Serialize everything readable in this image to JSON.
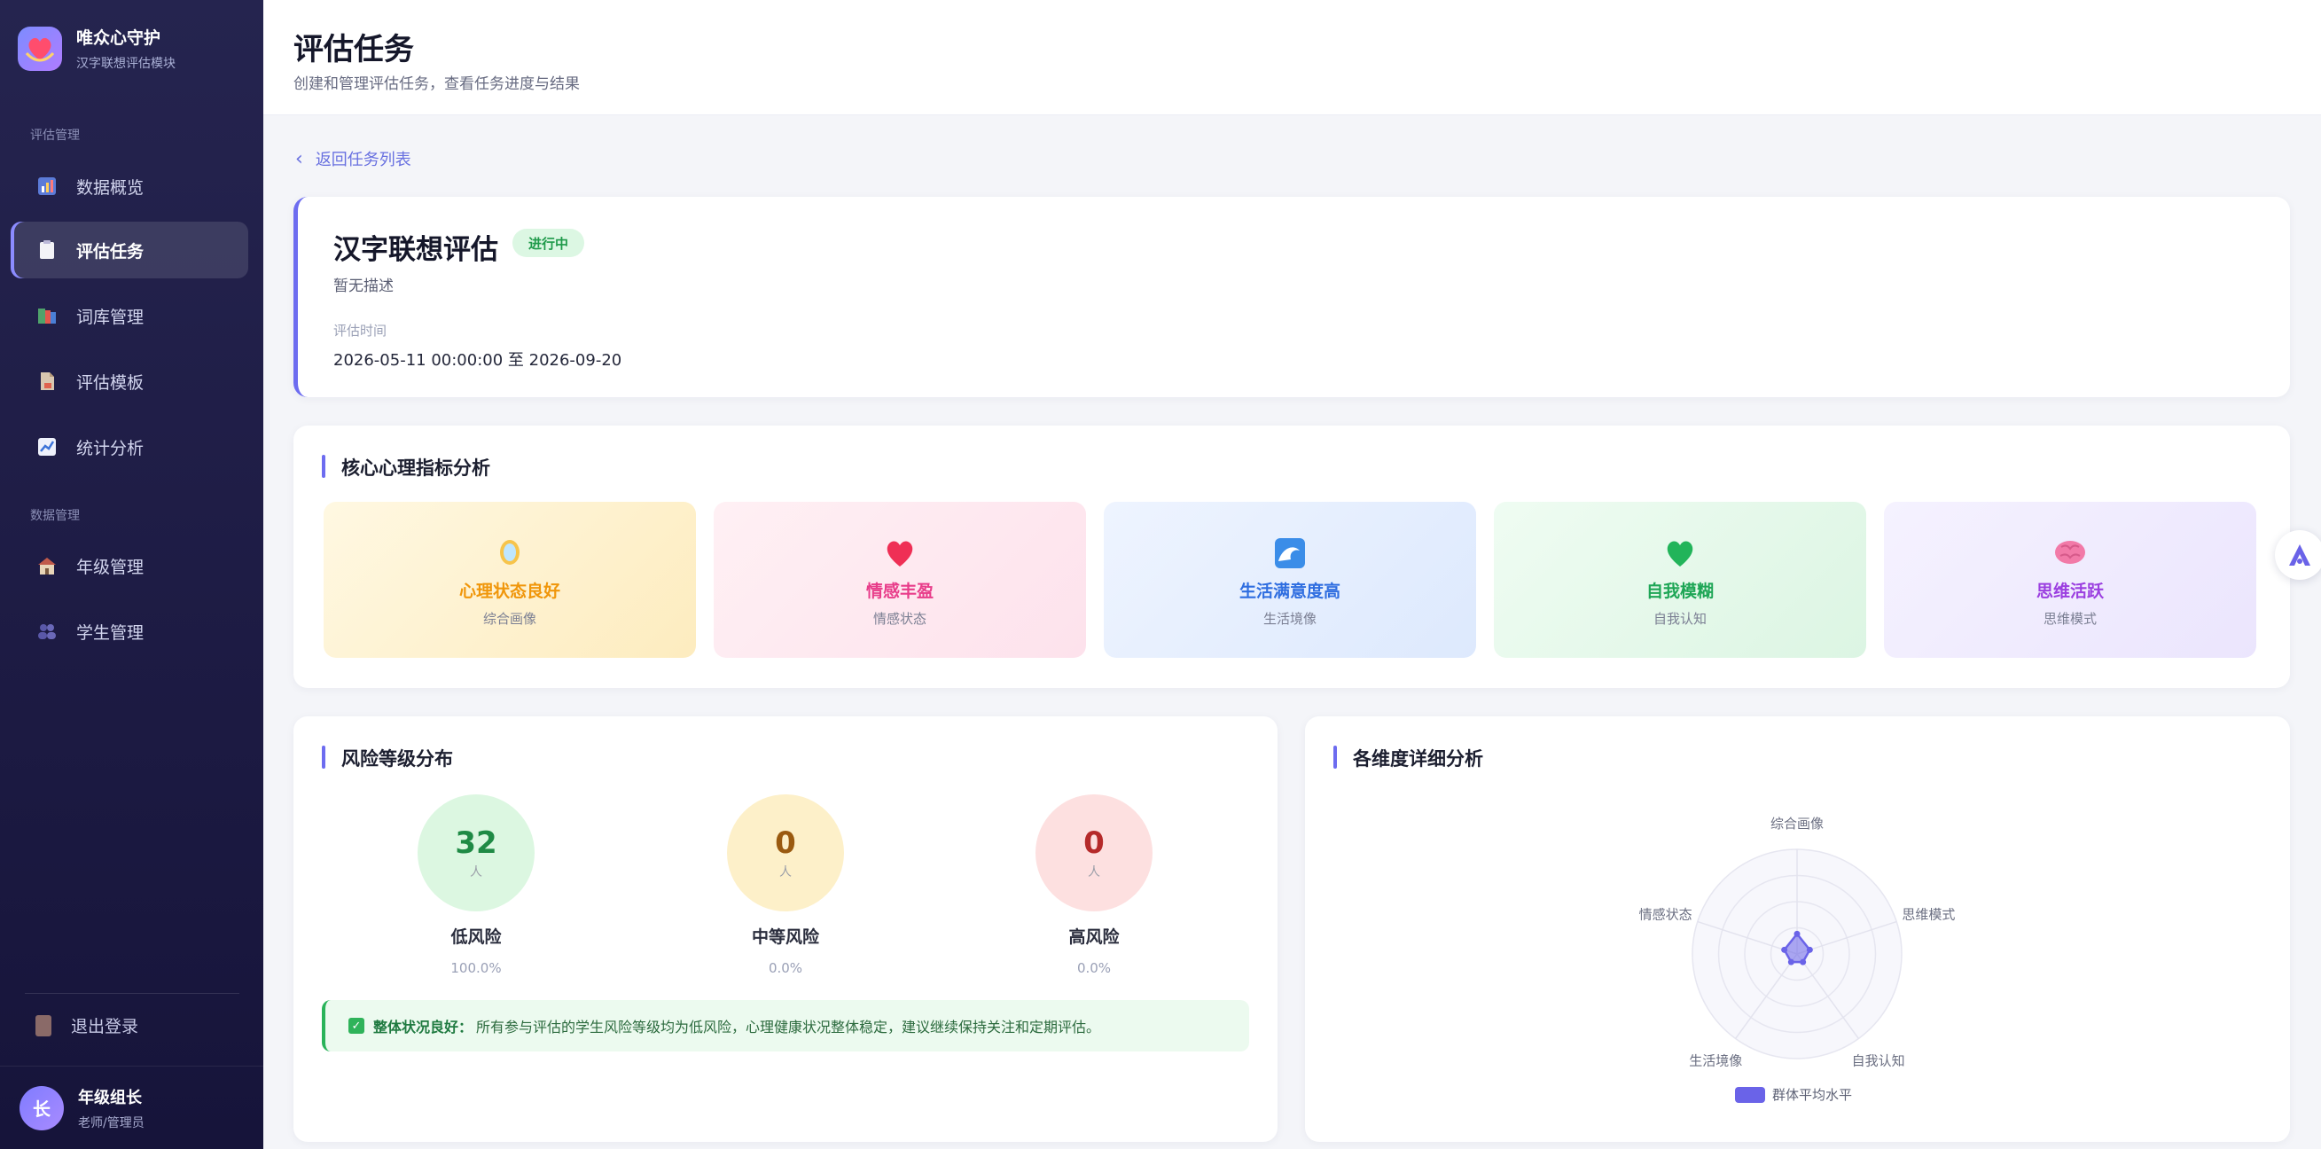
{
  "brand": {
    "title": "唯众心守护",
    "subtitle": "汉字联想评估模块"
  },
  "sidebar": {
    "section1": "评估管理",
    "section2": "数据管理",
    "items": [
      {
        "label": "数据概览",
        "icon": "bar-chart-icon"
      },
      {
        "label": "评估任务",
        "icon": "clipboard-icon"
      },
      {
        "label": "词库管理",
        "icon": "books-icon"
      },
      {
        "label": "评估模板",
        "icon": "document-icon"
      },
      {
        "label": "统计分析",
        "icon": "line-chart-icon"
      },
      {
        "label": "年级管理",
        "icon": "school-icon"
      },
      {
        "label": "学生管理",
        "icon": "students-icon"
      }
    ],
    "logout": "退出登录"
  },
  "user": {
    "avatar": "长",
    "name": "年级组长",
    "role": "老师/管理员"
  },
  "header": {
    "title": "评估任务",
    "subtitle": "创建和管理评估任务，查看任务进度与结果"
  },
  "back": "返回任务列表",
  "task": {
    "title": "汉字联想评估",
    "status": "进行中",
    "description": "暂无描述",
    "time_label": "评估时间",
    "time": "2026-05-11 00:00:00 至 2026-09-20"
  },
  "indicators": {
    "title": "核心心理指标分析",
    "items": [
      {
        "name": "心理状态良好",
        "category": "综合画像",
        "icon": "mirror-icon",
        "color": "#f0960a"
      },
      {
        "name": "情感丰盈",
        "category": "情感状态",
        "icon": "heart-icon",
        "color": "#e83d8a"
      },
      {
        "name": "生活满意度高",
        "category": "生活境像",
        "icon": "wave-icon",
        "color": "#2f6ee0"
      },
      {
        "name": "自我模糊",
        "category": "自我认知",
        "icon": "green-heart-icon",
        "color": "#1ea656"
      },
      {
        "name": "思维活跃",
        "category": "思维模式",
        "icon": "brain-icon",
        "color": "#9b3fe0"
      }
    ]
  },
  "risk": {
    "title": "风险等级分布",
    "items": [
      {
        "count": "32",
        "unit": "人",
        "label": "低风险",
        "pct": "100.0%",
        "color": "#1f8a45",
        "bg": "#dcf7e1"
      },
      {
        "count": "0",
        "unit": "人",
        "label": "中等风险",
        "pct": "0.0%",
        "color": "#9a5a10",
        "bg": "#fdf0c9"
      },
      {
        "count": "0",
        "unit": "人",
        "label": "高风险",
        "pct": "0.0%",
        "color": "#b52a2a",
        "bg": "#fde0e0"
      }
    ],
    "note_title": "整体状况良好：",
    "note_text": "所有参与评估的学生风险等级均为低风险，心理健康状况整体稳定，建议继续保持关注和定期评估。"
  },
  "radar": {
    "title": "各维度详细分析",
    "chart_data": {
      "type": "radar",
      "axes": [
        "综合画像",
        "思维模式",
        "自我认知",
        "生活境像",
        "情感状态"
      ],
      "series": [
        {
          "name": "群体平均水平",
          "values": [
            0.6,
            0.4,
            0.3,
            0.3,
            0.4
          ]
        }
      ],
      "max": 5
    }
  }
}
